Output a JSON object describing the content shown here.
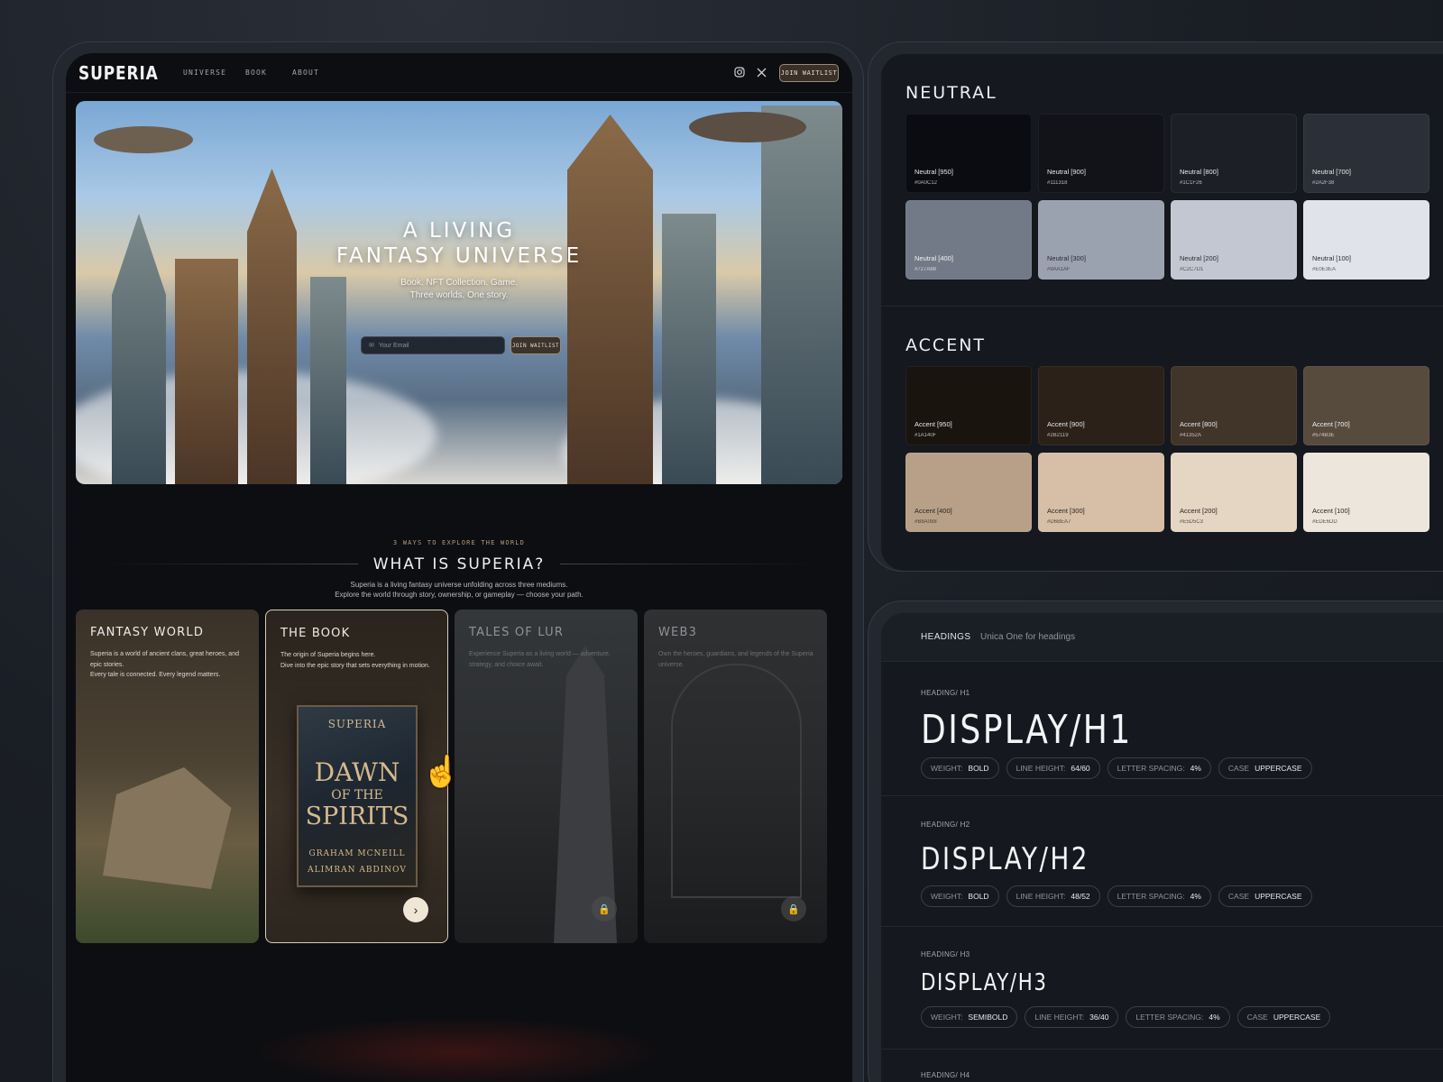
{
  "app": {
    "logo": "SUPERIA",
    "nav": [
      "UNIVERSE",
      "BOOK",
      "ABOUT"
    ],
    "join_waitlist": "JOIN WAITLIST"
  },
  "hero": {
    "title_line1": "A LIVING",
    "title_line2": "FANTASY UNIVERSE",
    "subtitle_line1": "Book. NFT Collection. Game.",
    "subtitle_line2": "Three worlds. One story.",
    "email_placeholder": "Your Email",
    "cta": "JOIN WAITLIST"
  },
  "section": {
    "eyebrow": "3 WAYS TO EXPLORE THE WORLD",
    "title": "WHAT IS SUPERIA?",
    "desc_line1": "Superia is a living fantasy universe unfolding across three mediums.",
    "desc_line2": "Explore the world through story, ownership, or gameplay — choose your path."
  },
  "cards": [
    {
      "title": "FANTASY WORLD",
      "desc": "Superia is a world of ancient clans, great heroes, and epic stories.\nEvery tale is connected. Every legend matters."
    },
    {
      "title": "THE BOOK",
      "desc": "The origin of Superia begins here.\nDive into the epic story that sets everything in motion.",
      "book_series": "SUPERIA",
      "book_title_1": "DAWN",
      "book_title_2": "OF THE",
      "book_title_3": "SPIRITS",
      "author_1": "GRAHAM MCNEILL",
      "author_2": "ALIMRAN ABDINOV"
    },
    {
      "title": "TALES OF LUR",
      "desc": "Experience Superia as a living world — adventure, strategy, and choice await."
    },
    {
      "title": "WEB3",
      "desc": "Own the heroes, guardians, and legends of the Superia universe."
    }
  ],
  "palette": {
    "neutral_title": "NEUTRAL",
    "accent_title": "ACCENT",
    "neutral": [
      {
        "name": "Neutral [950]",
        "hex": "#0A0C12",
        "color": "#0A0C12",
        "text": "#e8e8e8"
      },
      {
        "name": "Neutral [900]",
        "hex": "#111318",
        "color": "#111318",
        "text": "#e8e8e8"
      },
      {
        "name": "Neutral [800]",
        "hex": "#1C1F26",
        "color": "#1C1F26",
        "text": "#e8e8e8"
      },
      {
        "name": "Neutral [700]",
        "hex": "#2A2F38",
        "color": "#2A2F38",
        "text": "#e8e8e8"
      },
      {
        "name": "Neutral [400]",
        "hex": "#727A88",
        "color": "#727A88",
        "text": "#f2f2f2"
      },
      {
        "name": "Neutral [300]",
        "hex": "#9AA1AF",
        "color": "#9AA1AF",
        "text": "#2a2d33"
      },
      {
        "name": "Neutral [200]",
        "hex": "#C2C7D1",
        "color": "#C2C7D1",
        "text": "#2a2d33"
      },
      {
        "name": "Neutral [100]",
        "hex": "#E0E3EA",
        "color": "#E0E3EA",
        "text": "#2a2d33"
      }
    ],
    "accent": [
      {
        "name": "Accent [950]",
        "hex": "#1A140F",
        "color": "#1A140F",
        "text": "#e8e8e8"
      },
      {
        "name": "Accent [900]",
        "hex": "#2B2119",
        "color": "#2B2119",
        "text": "#e8e8e8"
      },
      {
        "name": "Accent [800]",
        "hex": "#41352A",
        "color": "#41352A",
        "text": "#e8e8e8"
      },
      {
        "name": "Accent [700]",
        "hex": "#574B3E",
        "color": "#574B3E",
        "text": "#f0f0f0"
      },
      {
        "name": "Accent [400]",
        "hex": "#B8A088",
        "color": "#B8A088",
        "text": "#2a2520"
      },
      {
        "name": "Accent [300]",
        "hex": "#D6BEA7",
        "color": "#D6BEA7",
        "text": "#2a2520"
      },
      {
        "name": "Accent [200]",
        "hex": "#E5D5C3",
        "color": "#E5D5C3",
        "text": "#2a2520"
      },
      {
        "name": "Accent [100]",
        "hex": "#EDE6DD",
        "color": "#EDE6DD",
        "text": "#2a2520"
      }
    ]
  },
  "headings": {
    "label": "HEADINGS",
    "font_note": "Unica One for headings",
    "rows": [
      {
        "tag": "HEADING/ H1",
        "sample": "DISPLAY/H1",
        "chips": [
          [
            "WEIGHT:",
            "BOLD"
          ],
          [
            "LINE HEIGHT:",
            "64/60"
          ],
          [
            "LETTER SPACING:",
            "4%"
          ],
          [
            "CASE",
            "UPPERCASE"
          ]
        ]
      },
      {
        "tag": "HEADING/ H2",
        "sample": "DISPLAY/H2",
        "chips": [
          [
            "WEIGHT:",
            "BOLD"
          ],
          [
            "LINE HEIGHT:",
            "48/52"
          ],
          [
            "LETTER SPACING:",
            "4%"
          ],
          [
            "CASE",
            "UPPERCASE"
          ]
        ]
      },
      {
        "tag": "HEADING/ H3",
        "sample": "DISPLAY/H3",
        "chips": [
          [
            "WEIGHT:",
            "SEMIBOLD"
          ],
          [
            "LINE HEIGHT:",
            "36/40"
          ],
          [
            "LETTER SPACING:",
            "4%"
          ],
          [
            "CASE",
            "UPPERCASE"
          ]
        ]
      },
      {
        "tag": "HEADING/ H4"
      }
    ]
  }
}
